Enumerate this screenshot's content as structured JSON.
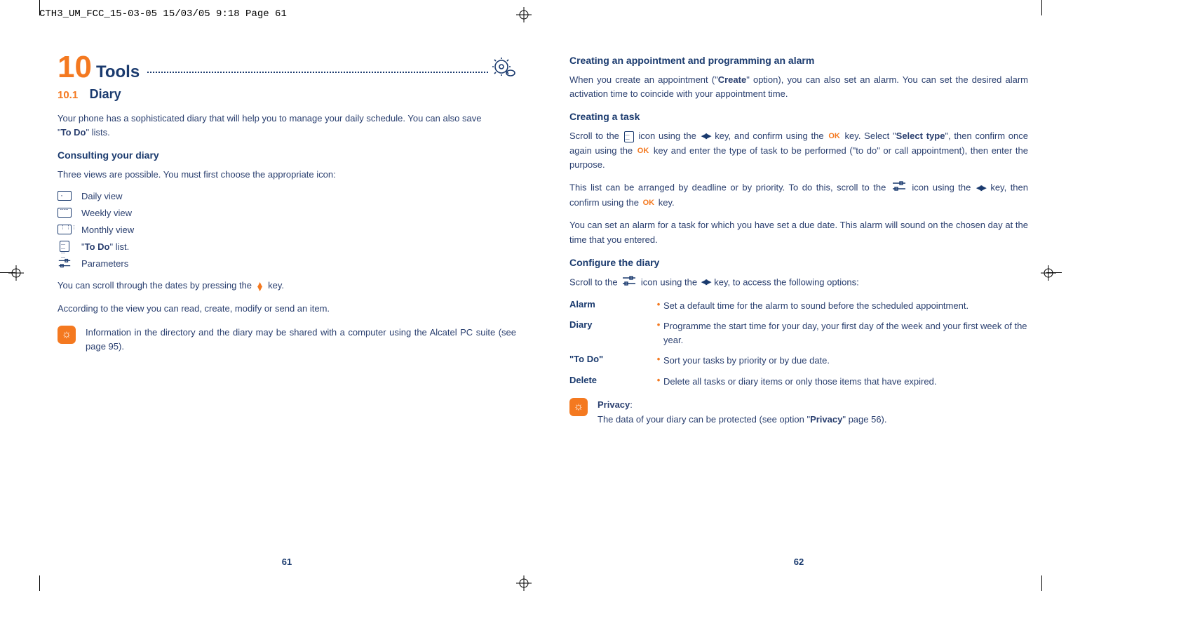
{
  "header": "CTH3_UM_FCC_15-03-05  15/03/05  9:18  Page 61",
  "chapter": {
    "num": "10",
    "title": "Tools"
  },
  "section": {
    "num": "10.1",
    "title": "Diary"
  },
  "left": {
    "intro1": "Your phone has a sophisticated diary that will help you to manage your daily schedule. You can also save",
    "intro2_pre": "\"",
    "intro2_bold": "To Do",
    "intro2_post": "\" lists.",
    "sub_consult": "Consulting your diary",
    "views_line": "Three views are possible. You must first choose the appropriate icon:",
    "items": {
      "daily": "Daily view",
      "weekly": "Weekly view",
      "monthly": "Monthly view",
      "todo_pre": "\"",
      "todo_bold": "To Do",
      "todo_post": "\" list.",
      "params": "Parameters"
    },
    "scroll_pre": "You can scroll through the dates by pressing the ",
    "scroll_post": " key.",
    "according": "According to the view you can read, create, modify or send an item.",
    "tip": "Information in the directory and the diary may be shared with a computer using the Alcatel PC suite (see page 95).",
    "pagenum": "61"
  },
  "right": {
    "sub_create_appt": "Creating an appointment and programming an alarm",
    "create_p1_a": "When you create an appointment (\"",
    "create_p1_b": "Create",
    "create_p1_c": "\" option), you can also set an alarm. You can set the desired alarm activation time to coincide with your appointment time.",
    "sub_create_task": "Creating a task",
    "task_p1_a": "Scroll to the ",
    "task_p1_b": " icon using the ",
    "task_p1_c": " key, and confirm using the ",
    "task_p1_d": " key. Select \"",
    "task_p1_e": "Select type",
    "task_p1_f": "\", then confirm once again using the ",
    "task_p1_g": " key and enter the type of task to be performed (\"to do\" or call appointment), then enter the purpose.",
    "task_p2_a": "This list can be arranged by deadline or by priority. To do this, scroll to the ",
    "task_p2_b": " icon using the ",
    "task_p2_c": " key, then confirm using the ",
    "task_p2_d": " key.",
    "task_p3": "You can set an alarm for a task for which you have set a due date. This alarm will sound on the chosen day at the time that you entered.",
    "sub_config": "Configure the diary",
    "config_p_a": "Scroll to the ",
    "config_p_b": " icon using the ",
    "config_p_c": " key, to access the following options:",
    "opts": {
      "alarm_l": "Alarm",
      "alarm_d": "Set a default time for the alarm to sound before the scheduled appointment.",
      "diary_l": "Diary",
      "diary_d": "Programme the start time for your day, your first day of the week and your first week of the year.",
      "todo_l": "\"To Do\"",
      "todo_d": "Sort your tasks by priority or by due date.",
      "delete_l": "Delete",
      "delete_d": "Delete all tasks or diary items or only those items that have expired."
    },
    "tip_label": "Privacy",
    "tip_colon": ":",
    "tip_body_a": "The data of your diary can be protected (see option \"",
    "tip_body_b": "Privacy",
    "tip_body_c": "\" page 56).",
    "pagenum": "62"
  },
  "ok": "OK"
}
